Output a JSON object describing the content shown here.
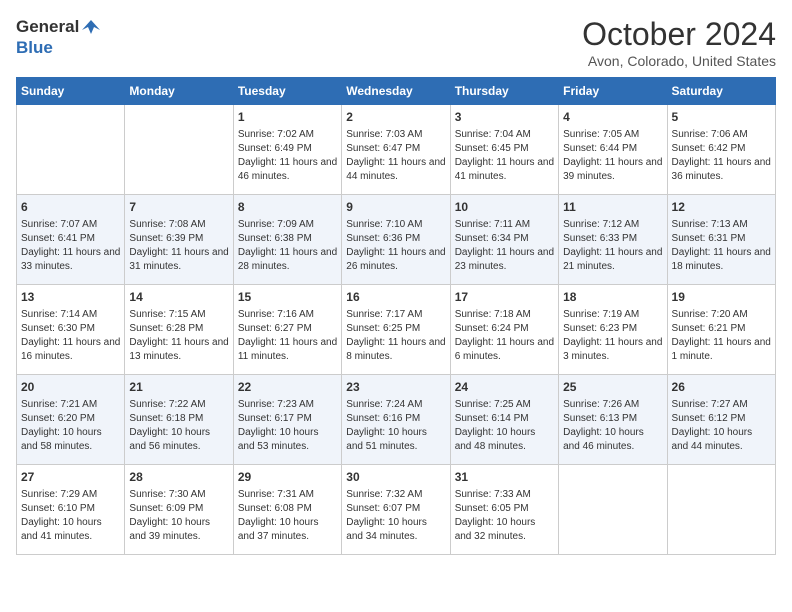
{
  "header": {
    "logo_general": "General",
    "logo_blue": "Blue",
    "month": "October 2024",
    "location": "Avon, Colorado, United States"
  },
  "days_of_week": [
    "Sunday",
    "Monday",
    "Tuesday",
    "Wednesday",
    "Thursday",
    "Friday",
    "Saturday"
  ],
  "weeks": [
    [
      {
        "day": "",
        "info": ""
      },
      {
        "day": "",
        "info": ""
      },
      {
        "day": "1",
        "info": "Sunrise: 7:02 AM\nSunset: 6:49 PM\nDaylight: 11 hours and 46 minutes."
      },
      {
        "day": "2",
        "info": "Sunrise: 7:03 AM\nSunset: 6:47 PM\nDaylight: 11 hours and 44 minutes."
      },
      {
        "day": "3",
        "info": "Sunrise: 7:04 AM\nSunset: 6:45 PM\nDaylight: 11 hours and 41 minutes."
      },
      {
        "day": "4",
        "info": "Sunrise: 7:05 AM\nSunset: 6:44 PM\nDaylight: 11 hours and 39 minutes."
      },
      {
        "day": "5",
        "info": "Sunrise: 7:06 AM\nSunset: 6:42 PM\nDaylight: 11 hours and 36 minutes."
      }
    ],
    [
      {
        "day": "6",
        "info": "Sunrise: 7:07 AM\nSunset: 6:41 PM\nDaylight: 11 hours and 33 minutes."
      },
      {
        "day": "7",
        "info": "Sunrise: 7:08 AM\nSunset: 6:39 PM\nDaylight: 11 hours and 31 minutes."
      },
      {
        "day": "8",
        "info": "Sunrise: 7:09 AM\nSunset: 6:38 PM\nDaylight: 11 hours and 28 minutes."
      },
      {
        "day": "9",
        "info": "Sunrise: 7:10 AM\nSunset: 6:36 PM\nDaylight: 11 hours and 26 minutes."
      },
      {
        "day": "10",
        "info": "Sunrise: 7:11 AM\nSunset: 6:34 PM\nDaylight: 11 hours and 23 minutes."
      },
      {
        "day": "11",
        "info": "Sunrise: 7:12 AM\nSunset: 6:33 PM\nDaylight: 11 hours and 21 minutes."
      },
      {
        "day": "12",
        "info": "Sunrise: 7:13 AM\nSunset: 6:31 PM\nDaylight: 11 hours and 18 minutes."
      }
    ],
    [
      {
        "day": "13",
        "info": "Sunrise: 7:14 AM\nSunset: 6:30 PM\nDaylight: 11 hours and 16 minutes."
      },
      {
        "day": "14",
        "info": "Sunrise: 7:15 AM\nSunset: 6:28 PM\nDaylight: 11 hours and 13 minutes."
      },
      {
        "day": "15",
        "info": "Sunrise: 7:16 AM\nSunset: 6:27 PM\nDaylight: 11 hours and 11 minutes."
      },
      {
        "day": "16",
        "info": "Sunrise: 7:17 AM\nSunset: 6:25 PM\nDaylight: 11 hours and 8 minutes."
      },
      {
        "day": "17",
        "info": "Sunrise: 7:18 AM\nSunset: 6:24 PM\nDaylight: 11 hours and 6 minutes."
      },
      {
        "day": "18",
        "info": "Sunrise: 7:19 AM\nSunset: 6:23 PM\nDaylight: 11 hours and 3 minutes."
      },
      {
        "day": "19",
        "info": "Sunrise: 7:20 AM\nSunset: 6:21 PM\nDaylight: 11 hours and 1 minute."
      }
    ],
    [
      {
        "day": "20",
        "info": "Sunrise: 7:21 AM\nSunset: 6:20 PM\nDaylight: 10 hours and 58 minutes."
      },
      {
        "day": "21",
        "info": "Sunrise: 7:22 AM\nSunset: 6:18 PM\nDaylight: 10 hours and 56 minutes."
      },
      {
        "day": "22",
        "info": "Sunrise: 7:23 AM\nSunset: 6:17 PM\nDaylight: 10 hours and 53 minutes."
      },
      {
        "day": "23",
        "info": "Sunrise: 7:24 AM\nSunset: 6:16 PM\nDaylight: 10 hours and 51 minutes."
      },
      {
        "day": "24",
        "info": "Sunrise: 7:25 AM\nSunset: 6:14 PM\nDaylight: 10 hours and 48 minutes."
      },
      {
        "day": "25",
        "info": "Sunrise: 7:26 AM\nSunset: 6:13 PM\nDaylight: 10 hours and 46 minutes."
      },
      {
        "day": "26",
        "info": "Sunrise: 7:27 AM\nSunset: 6:12 PM\nDaylight: 10 hours and 44 minutes."
      }
    ],
    [
      {
        "day": "27",
        "info": "Sunrise: 7:29 AM\nSunset: 6:10 PM\nDaylight: 10 hours and 41 minutes."
      },
      {
        "day": "28",
        "info": "Sunrise: 7:30 AM\nSunset: 6:09 PM\nDaylight: 10 hours and 39 minutes."
      },
      {
        "day": "29",
        "info": "Sunrise: 7:31 AM\nSunset: 6:08 PM\nDaylight: 10 hours and 37 minutes."
      },
      {
        "day": "30",
        "info": "Sunrise: 7:32 AM\nSunset: 6:07 PM\nDaylight: 10 hours and 34 minutes."
      },
      {
        "day": "31",
        "info": "Sunrise: 7:33 AM\nSunset: 6:05 PM\nDaylight: 10 hours and 32 minutes."
      },
      {
        "day": "",
        "info": ""
      },
      {
        "day": "",
        "info": ""
      }
    ]
  ]
}
